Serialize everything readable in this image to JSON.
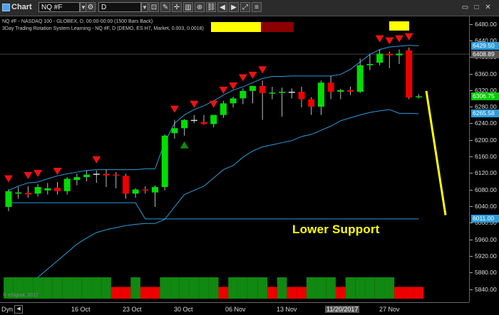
{
  "toolbar": {
    "app_title": "Chart",
    "symbol_value": "NQ #F",
    "interval_value": "D"
  },
  "chart_info": {
    "line1": "NQ #F - NASDAQ 100 - GLOBEX, D, 00:00-00:00 (1500 Bars Back)",
    "line2": "3Day Trading Rotation System Learning - NQ #F, D (DEMO, ES H7, Market, 0.003, 0.0018)"
  },
  "y_axis": {
    "ticks": [
      "6480.00",
      "6440.00",
      "6400.00",
      "6360.00",
      "6320.00",
      "6280.00",
      "6240.00",
      "6200.00",
      "6160.00",
      "6120.00",
      "6080.00",
      "6040.00",
      "6000.00",
      "5960.00",
      "5920.00",
      "5880.00",
      "5840.00"
    ],
    "price_tags": {
      "upper_band": "6429.50",
      "reference": "6408.89",
      "last": "6306.75",
      "lower_band": "6265.58",
      "support": "6011.00"
    }
  },
  "x_axis": {
    "dyn_label": "Dyn",
    "labels": [
      "16 Oct",
      "23 Oct",
      "30 Oct",
      "06 Nov",
      "13 Nov",
      "11/20/2017",
      "27 Nov"
    ]
  },
  "annotation": "Lower Support",
  "watermark": "© eSignal, 2017",
  "colors": {
    "up_candle": "#00dd00",
    "down_candle": "#ee0000",
    "doji": "#dddddd",
    "band": "#2d9cdb",
    "signal_arrow": "#ee1111",
    "annotation": "#ffff00"
  },
  "chart_data": {
    "type": "candlestick",
    "ylim": [
      5810,
      6500
    ],
    "candles": [
      {
        "o": 6040,
        "h": 6082,
        "l": 6030,
        "c": 6078
      },
      {
        "o": 6072,
        "h": 6088,
        "l": 6060,
        "c": 6075
      },
      {
        "o": 6074,
        "h": 6090,
        "l": 6062,
        "c": 6070
      },
      {
        "o": 6072,
        "h": 6095,
        "l": 6065,
        "c": 6088
      },
      {
        "o": 6080,
        "h": 6098,
        "l": 6070,
        "c": 6085
      },
      {
        "o": 6086,
        "h": 6100,
        "l": 6070,
        "c": 6078
      },
      {
        "o": 6078,
        "h": 6112,
        "l": 6070,
        "c": 6108
      },
      {
        "o": 6105,
        "h": 6120,
        "l": 6092,
        "c": 6112
      },
      {
        "o": 6112,
        "h": 6128,
        "l": 6102,
        "c": 6118
      },
      {
        "o": 6120,
        "h": 6128,
        "l": 6098,
        "c": 6120
      },
      {
        "o": 6120,
        "h": 6130,
        "l": 6088,
        "c": 6116
      },
      {
        "o": 6118,
        "h": 6124,
        "l": 6085,
        "c": 6116
      },
      {
        "o": 6115,
        "h": 6120,
        "l": 6060,
        "c": 6072
      },
      {
        "o": 6072,
        "h": 6085,
        "l": 6062,
        "c": 6082
      },
      {
        "o": 6082,
        "h": 6090,
        "l": 6072,
        "c": 6080
      },
      {
        "o": 6075,
        "h": 6092,
        "l": 6040,
        "c": 6088
      },
      {
        "o": 6088,
        "h": 6215,
        "l": 6080,
        "c": 6212
      },
      {
        "o": 6218,
        "h": 6250,
        "l": 6205,
        "c": 6230
      },
      {
        "o": 6230,
        "h": 6252,
        "l": 6212,
        "c": 6250
      },
      {
        "o": 6250,
        "h": 6262,
        "l": 6242,
        "c": 6250
      },
      {
        "o": 6245,
        "h": 6262,
        "l": 6238,
        "c": 6240
      },
      {
        "o": 6240,
        "h": 6262,
        "l": 6232,
        "c": 6262
      },
      {
        "o": 6262,
        "h": 6296,
        "l": 6255,
        "c": 6290
      },
      {
        "o": 6290,
        "h": 6306,
        "l": 6280,
        "c": 6302
      },
      {
        "o": 6302,
        "h": 6326,
        "l": 6288,
        "c": 6320
      },
      {
        "o": 6320,
        "h": 6332,
        "l": 6290,
        "c": 6332
      },
      {
        "o": 6332,
        "h": 6345,
        "l": 6250,
        "c": 6315
      },
      {
        "o": 6315,
        "h": 6330,
        "l": 6300,
        "c": 6316
      },
      {
        "o": 6316,
        "h": 6328,
        "l": 6258,
        "c": 6318
      },
      {
        "o": 6318,
        "h": 6326,
        "l": 6302,
        "c": 6318
      },
      {
        "o": 6318,
        "h": 6330,
        "l": 6280,
        "c": 6300
      },
      {
        "o": 6300,
        "h": 6305,
        "l": 6262,
        "c": 6282
      },
      {
        "o": 6282,
        "h": 6345,
        "l": 6262,
        "c": 6340
      },
      {
        "o": 6340,
        "h": 6356,
        "l": 6300,
        "c": 6318
      },
      {
        "o": 6318,
        "h": 6325,
        "l": 6300,
        "c": 6322
      },
      {
        "o": 6322,
        "h": 6330,
        "l": 6310,
        "c": 6318
      },
      {
        "o": 6318,
        "h": 6398,
        "l": 6315,
        "c": 6382
      },
      {
        "o": 6382,
        "h": 6410,
        "l": 6370,
        "c": 6385
      },
      {
        "o": 6388,
        "h": 6420,
        "l": 6382,
        "c": 6410
      },
      {
        "o": 6410,
        "h": 6415,
        "l": 6375,
        "c": 6406
      },
      {
        "o": 6406,
        "h": 6420,
        "l": 6385,
        "c": 6410
      },
      {
        "o": 6418,
        "h": 6425,
        "l": 6300,
        "c": 6304
      },
      {
        "o": 6306,
        "h": 6312,
        "l": 6302,
        "c": 6307
      }
    ],
    "upper_band": [
      6080,
      6090,
      6098,
      6100,
      6108,
      6115,
      6120,
      6124,
      6128,
      6130,
      6130,
      6130,
      6130,
      6130,
      6132,
      6132,
      6196,
      6242,
      6262,
      6275,
      6284,
      6296,
      6310,
      6322,
      6330,
      6340,
      6350,
      6355,
      6355,
      6356,
      6356,
      6356,
      6356,
      6356,
      6360,
      6372,
      6390,
      6408,
      6420,
      6426,
      6428,
      6430,
      6429
    ],
    "lower_band": [
      5820,
      5830,
      5850,
      5870,
      5890,
      5910,
      5930,
      5950,
      5965,
      5978,
      5985,
      5990,
      5995,
      5998,
      6000,
      6000,
      6010,
      6040,
      6070,
      6080,
      6090,
      6110,
      6130,
      6140,
      6160,
      6175,
      6185,
      6190,
      6195,
      6200,
      6210,
      6215,
      6225,
      6235,
      6248,
      6255,
      6262,
      6268,
      6272,
      6275,
      6266,
      6266,
      6265
    ],
    "support_line": [
      6050,
      6050,
      6050,
      6050,
      6050,
      6050,
      6050,
      6050,
      6050,
      6050,
      6050,
      6050,
      6050,
      6050,
      6011,
      6011,
      6011,
      6011,
      6011,
      6011,
      6011,
      6011,
      6011,
      6011,
      6011,
      6011,
      6011,
      6011,
      6011,
      6011,
      6011,
      6011,
      6011,
      6011,
      6011,
      6011,
      6011,
      6011,
      6011,
      6011,
      6011,
      6011,
      6011
    ],
    "sell_signals": [
      0,
      2,
      3,
      5,
      9,
      17,
      19,
      21,
      22,
      23,
      24,
      25,
      26,
      38,
      39,
      40,
      41
    ],
    "buy_signals": [
      18
    ],
    "yellow_markers": [
      40
    ],
    "bottom_bars": [
      "g",
      "g",
      "g",
      "g",
      "g",
      "g",
      "g",
      "g",
      "g",
      "g",
      "g",
      "r",
      "r",
      "g",
      "r",
      "r",
      "g",
      "g",
      "g",
      "g",
      "g",
      "g",
      "r",
      "g",
      "g",
      "g",
      "g",
      "r",
      "g",
      "r",
      "r",
      "g",
      "g",
      "g",
      "r",
      "g",
      "g",
      "g",
      "g",
      "g",
      "r",
      "r",
      "r"
    ],
    "trend_projection": [
      [
        6320,
        6020
      ]
    ],
    "last_price": 6306.75
  }
}
